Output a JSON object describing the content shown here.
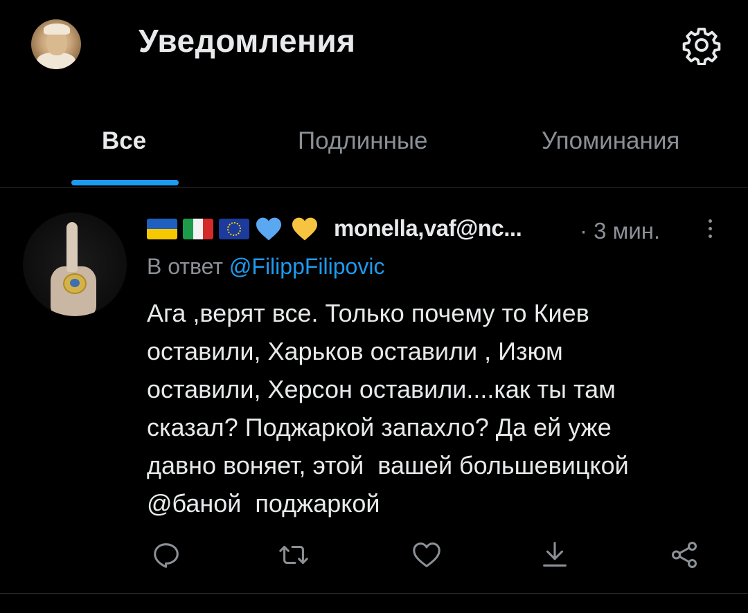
{
  "header": {
    "title": "Уведомления"
  },
  "tabs": [
    {
      "label": "Все",
      "active": true
    },
    {
      "label": "Подлинные",
      "active": false
    },
    {
      "label": "Упоминания",
      "active": false
    }
  ],
  "tweet": {
    "display_name_emoji": [
      "ukraine-flag",
      "italy-flag",
      "eu-flag",
      "blue-heart",
      "yellow-heart"
    ],
    "handle": "monella,vaf@nc...",
    "timestamp": "· 3 мин.",
    "reply_prefix": "В ответ",
    "reply_to": "@FilippFilipovic",
    "text": "Ага ,верят все. Только почему то Киев\nоставили, Харьков оставили , Изюм\nоставили, Херсон оставили....как ты там\nсказал? Поджаркой запахло? Да ей уже\nдавно воняет, этой  вашей большевицкой\n@баной  поджаркой"
  },
  "actions": [
    "reply-icon",
    "retweet-icon",
    "like-icon",
    "download-icon",
    "share-icon"
  ],
  "colors": {
    "background": "#000000",
    "accent": "#1d9bf0",
    "text": "#e7e9ea",
    "muted": "#8b9096"
  }
}
